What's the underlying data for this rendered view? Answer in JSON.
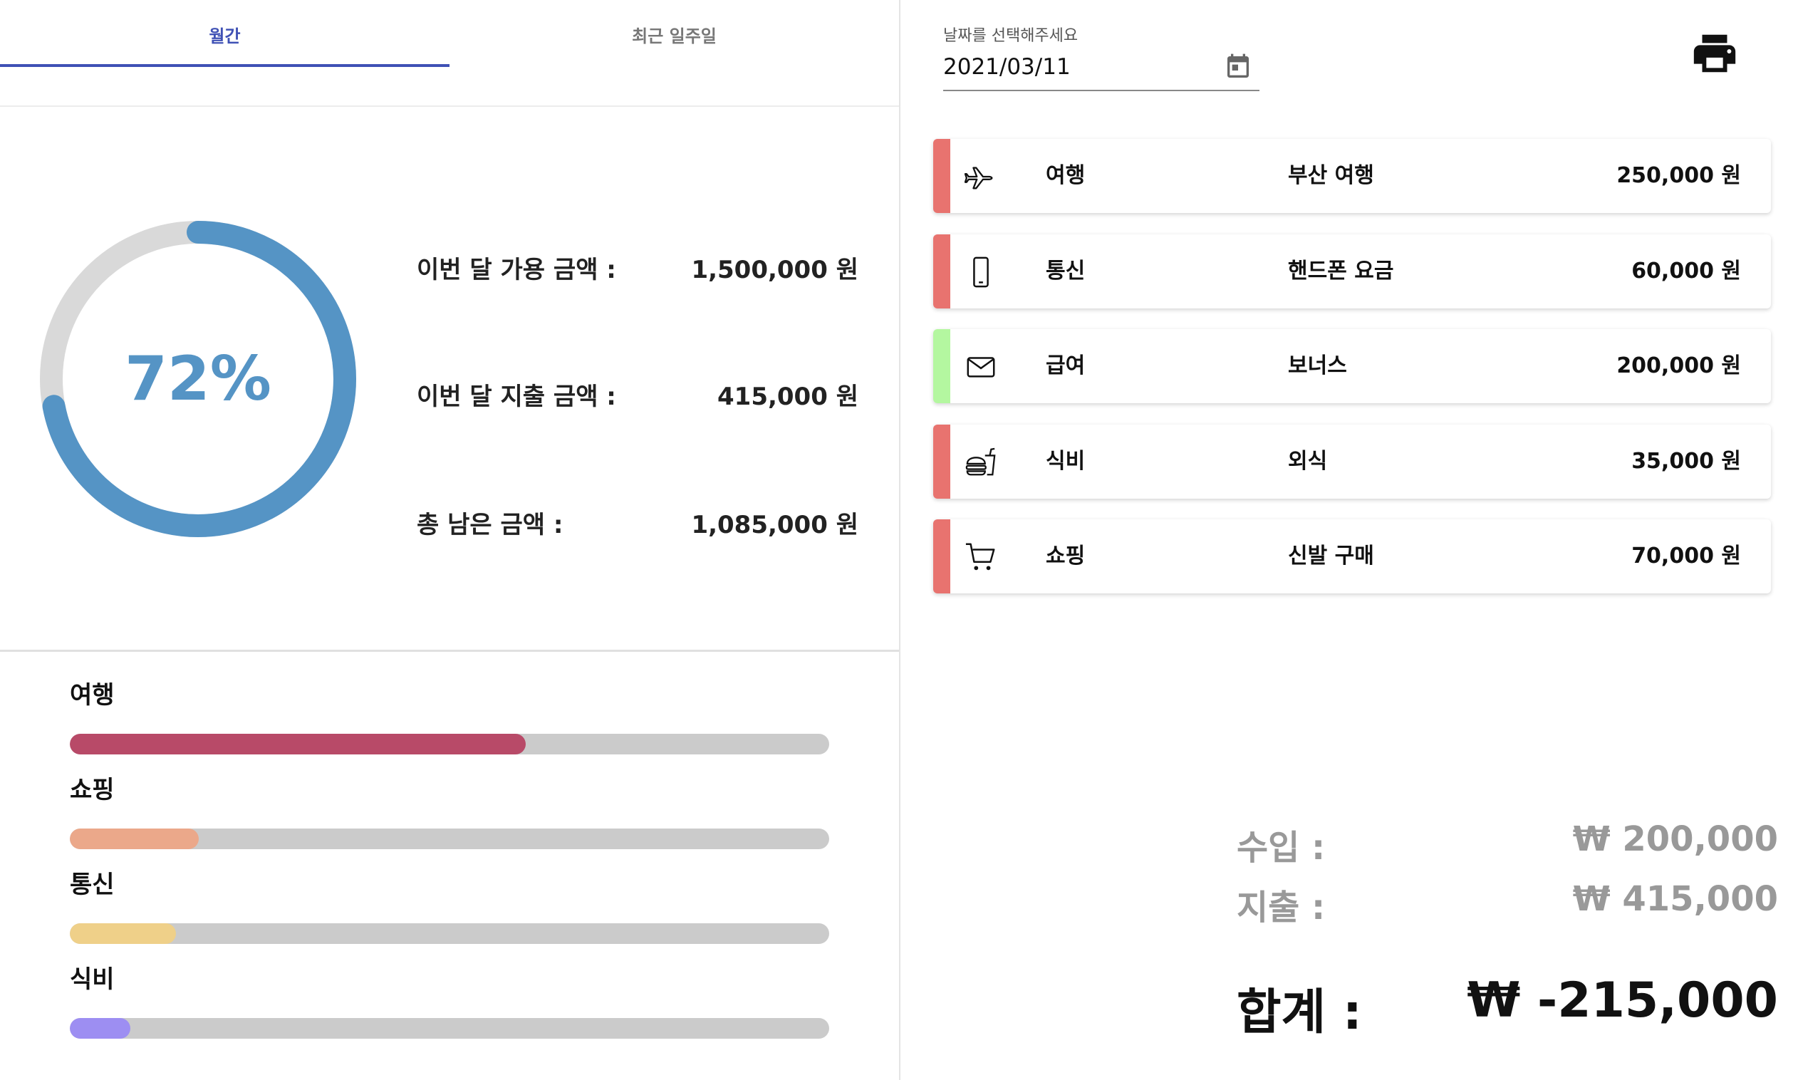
{
  "tabs": [
    {
      "label": "월간",
      "active": true
    },
    {
      "label": "최근 일주일",
      "active": false
    }
  ],
  "summary": {
    "percent_label": "72%",
    "percent_value": 0.72,
    "rows": [
      {
        "label": "이번 달 가용 금액 :",
        "value": "1,500,000 원"
      },
      {
        "label": "이번 달 지출 금액 :",
        "value": "415,000 원"
      },
      {
        "label": "총 남은 금액 :",
        "value": "1,085,000 원"
      }
    ]
  },
  "categories": [
    {
      "label": "여행",
      "fraction": 0.6,
      "color": "#b84a68"
    },
    {
      "label": "쇼핑",
      "fraction": 0.17,
      "color": "#eba88a"
    },
    {
      "label": "통신",
      "fraction": 0.14,
      "color": "#efd089"
    },
    {
      "label": "식비",
      "fraction": 0.08,
      "color": "#9d8ef2"
    }
  ],
  "date_picker": {
    "label": "날짜를 선택해주세요",
    "value": "2021/03/11"
  },
  "transactions": [
    {
      "icon": "airplane-icon",
      "category": "여행",
      "description": "부산 여행",
      "amount": "250,000 원",
      "color": "#e8736f"
    },
    {
      "icon": "smartphone-icon",
      "category": "통신",
      "description": "핸드폰 요금",
      "amount": "60,000 원",
      "color": "#e8736f"
    },
    {
      "icon": "mail-icon",
      "category": "급여",
      "description": "보너스",
      "amount": "200,000 원",
      "color": "#b4f7a0"
    },
    {
      "icon": "fastfood-icon",
      "category": "식비",
      "description": "외식",
      "amount": "35,000 원",
      "color": "#e8736f"
    },
    {
      "icon": "cart-icon",
      "category": "쇼핑",
      "description": "신발 구매",
      "amount": "70,000 원",
      "color": "#e8736f"
    }
  ],
  "totals": {
    "income_label": "수입 :",
    "income_value": "₩ 200,000",
    "expense_label": "지출 :",
    "expense_value": "₩ 415,000",
    "total_label": "합계 :",
    "total_value": "₩ -215,000"
  },
  "colors": {
    "accent": "#3f51b5",
    "ring": "#5594c5",
    "ring_track": "#d9d9d9"
  }
}
